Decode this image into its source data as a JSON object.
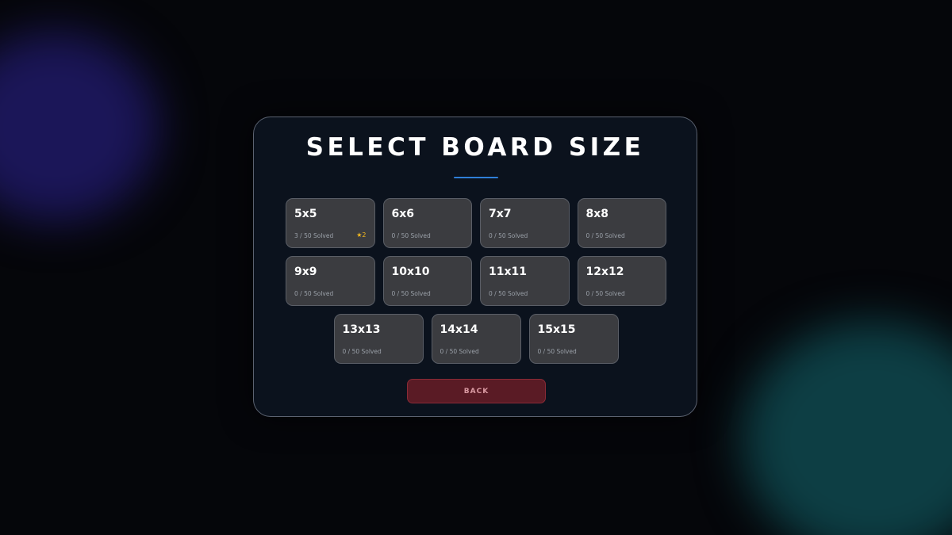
{
  "title": "SELECT BOARD SIZE",
  "colors": {
    "background": "#05060a",
    "panel": "#0b121d",
    "card": "#3b3c40",
    "accent_line": "#2f7fd8",
    "star": "#f3b81f",
    "back_button": "#5a1b25"
  },
  "rows": [
    [
      {
        "label": "5x5",
        "progress": "3 / 50 Solved",
        "stars": "★2"
      },
      {
        "label": "6x6",
        "progress": "0 / 50 Solved",
        "stars": ""
      },
      {
        "label": "7x7",
        "progress": "0 / 50 Solved",
        "stars": ""
      },
      {
        "label": "8x8",
        "progress": "0 / 50 Solved",
        "stars": ""
      }
    ],
    [
      {
        "label": "9x9",
        "progress": "0 / 50 Solved",
        "stars": ""
      },
      {
        "label": "10x10",
        "progress": "0 / 50 Solved",
        "stars": ""
      },
      {
        "label": "11x11",
        "progress": "0 / 50 Solved",
        "stars": ""
      },
      {
        "label": "12x12",
        "progress": "0 / 50 Solved",
        "stars": ""
      }
    ],
    [
      {
        "label": "13x13",
        "progress": "0 / 50 Solved",
        "stars": ""
      },
      {
        "label": "14x14",
        "progress": "0 / 50 Solved",
        "stars": ""
      },
      {
        "label": "15x15",
        "progress": "0 / 50 Solved",
        "stars": ""
      }
    ]
  ],
  "back_label": "BACK"
}
